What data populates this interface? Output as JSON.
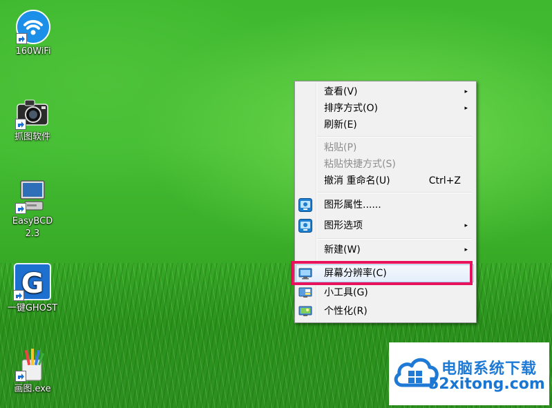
{
  "desktop": {
    "icons": [
      {
        "label": "160WiFi",
        "icon": "wifi-icon"
      },
      {
        "label": "抓图软件",
        "icon": "camera-icon"
      },
      {
        "label": "EasyBCD",
        "label2": "2.3",
        "icon": "computer-icon"
      },
      {
        "label": "一键GHOST",
        "icon": "ghost-icon"
      },
      {
        "label": "画图.exe",
        "icon": "paint-icon"
      }
    ]
  },
  "context_menu": {
    "items": [
      {
        "label": "查看(V)",
        "submenu": true
      },
      {
        "label": "排序方式(O)",
        "submenu": true
      },
      {
        "label": "刷新(E)"
      },
      {
        "label": "粘贴(P)",
        "disabled": true
      },
      {
        "label": "粘贴快捷方式(S)",
        "disabled": true
      },
      {
        "label": "撤消 重命名(U)",
        "shortcut": "Ctrl+Z"
      },
      {
        "label": "图形属性......",
        "icon": "intel-graphics-icon"
      },
      {
        "label": "图形选项",
        "icon": "intel-graphics-icon",
        "submenu": true
      },
      {
        "label": "新建(W)",
        "submenu": true
      },
      {
        "label": "屏幕分辨率(C)",
        "icon": "display-icon",
        "highlighted": true
      },
      {
        "label": "小工具(G)",
        "icon": "gadgets-icon"
      },
      {
        "label": "个性化(R)",
        "icon": "personalize-icon"
      }
    ],
    "submenu_arrow": "▸"
  },
  "highlight_color": "#e8125c",
  "watermark": {
    "title": "电脑系统下载",
    "url": "52xitong.com",
    "color": "#1f7ad6"
  }
}
